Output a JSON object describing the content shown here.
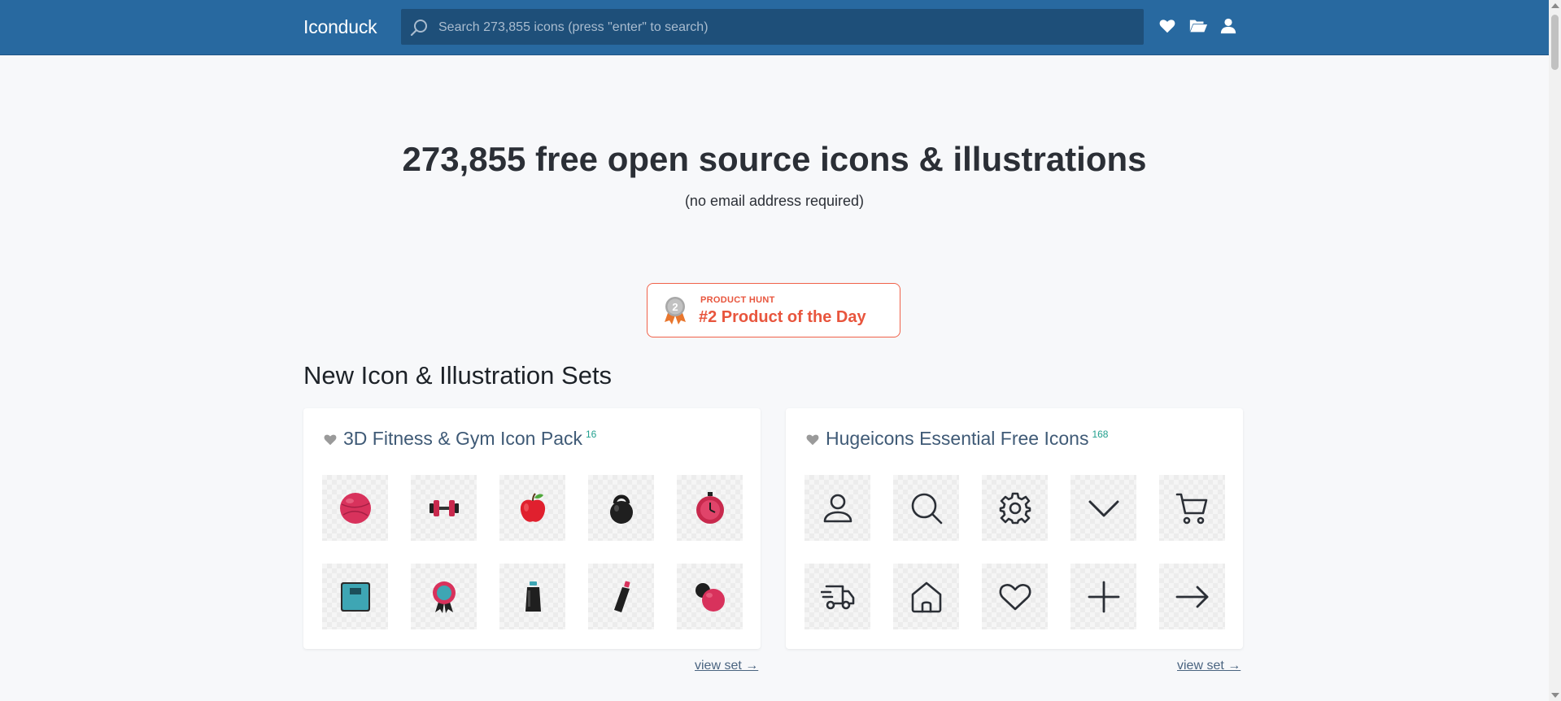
{
  "header": {
    "brand": "Iconduck",
    "search_placeholder": "Search 273,855 icons (press \"enter\" to search)",
    "nav_icons": [
      "heart-icon",
      "folder-open-icon",
      "user-icon"
    ]
  },
  "hero": {
    "title": "273,855 free open source icons & illustrations",
    "subtitle": "(no email address required)"
  },
  "product_hunt": {
    "small_label": "PRODUCT HUNT",
    "title": "#2 Product of the Day",
    "medal_number": "2"
  },
  "sections": {
    "new_sets_title": "New Icon & Illustration Sets"
  },
  "sets": [
    {
      "title": "3D Fitness & Gym Icon Pack",
      "count": "16",
      "view_label": "view set →",
      "icons": [
        "fitness-ball-icon",
        "dumbbell-icon",
        "apple-icon",
        "kettlebell-icon",
        "stopwatch-icon",
        "scale-icon",
        "award-ribbon-icon",
        "water-bottle-icon",
        "sport-bottle-icon",
        "balls-icon"
      ]
    },
    {
      "title": "Hugeicons Essential Free Icons",
      "count": "168",
      "view_label": "view set →",
      "icons": [
        "user-icon",
        "search-icon",
        "settings-gear-icon",
        "chevron-down-icon",
        "shopping-cart-icon",
        "delivery-truck-icon",
        "home-icon",
        "heart-icon",
        "plus-icon",
        "arrow-right-icon"
      ]
    }
  ],
  "colors": {
    "header_bg": "#2869a0",
    "search_bg": "#1e4f79",
    "accent": "#e8553d",
    "count_color": "#22a08e",
    "page_bg": "#f7f8fa"
  }
}
